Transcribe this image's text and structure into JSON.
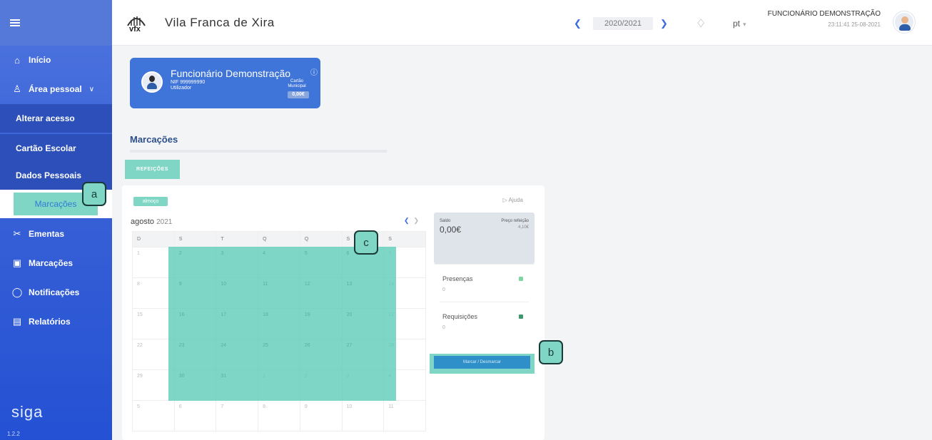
{
  "sidebar": {
    "items": [
      {
        "icon": "home-icon",
        "glyph": "⌂",
        "label": "Início"
      },
      {
        "icon": "person-icon",
        "glyph": "♙",
        "label": "Área pessoal"
      },
      {
        "label": "Alterar acesso"
      },
      {
        "label": "Cartão Escolar"
      },
      {
        "label": "Dados Pessoais"
      },
      {
        "label": "Marcações"
      },
      {
        "icon": "cutlery-icon",
        "glyph": "✂",
        "label": "Ementas"
      },
      {
        "icon": "calendar-icon",
        "glyph": "▣",
        "label": "Marcações"
      },
      {
        "icon": "bell-icon",
        "glyph": "♫",
        "label": "Notificações"
      },
      {
        "icon": "report-icon",
        "glyph": "▤",
        "label": "Relatórios"
      }
    ],
    "brand": "siga",
    "version": "1.2.2"
  },
  "header": {
    "logo_text": "vfx",
    "title": "Vila Franca de Xira",
    "year": "2020/2021",
    "lang": "pt",
    "user_name": "FUNCIONÁRIO DEMONSTRAÇÃO",
    "user_time": "23:11:41 25-08-2021"
  },
  "user_card": {
    "name": "Funcionário Demonstração",
    "info_icon": "ⓘ",
    "nif": "NIF 999999990",
    "role": "Utilizador",
    "cartao": "Cartão Municipal",
    "saldo": "0,00€"
  },
  "section": {
    "title": "Marcações",
    "tab": "REFEIÇÕES"
  },
  "panel": {
    "chip": "almoço",
    "help": "Ajuda",
    "month": "agosto",
    "year": "2021",
    "weekdays": [
      "D",
      "S",
      "T",
      "Q",
      "Q",
      "S",
      "S"
    ],
    "weeks": [
      [
        "1",
        "2",
        "3",
        "4",
        "5",
        "6",
        "7"
      ],
      [
        "8",
        "9",
        "10",
        "11",
        "12",
        "13",
        "14"
      ],
      [
        "15",
        "16",
        "17",
        "18",
        "19",
        "20",
        "21"
      ],
      [
        "22",
        "23",
        "24",
        "25",
        "26",
        "27",
        "28"
      ],
      [
        "29",
        "30",
        "31",
        "1",
        "2",
        "3",
        "4"
      ],
      [
        "5",
        "6",
        "7",
        "8",
        "9",
        "10",
        "11"
      ]
    ],
    "saldo_label": "Saldo",
    "saldo_value": "0,00€",
    "preco_label": "Preço refeição",
    "preco_value": "4,10€",
    "presencas_label": "Presenças",
    "presencas_value": "0",
    "requisicoes_label": "Requisições",
    "requisicoes_value": "0",
    "mark_button": "Marcar / Desmarcar"
  },
  "badges": {
    "a": "a",
    "b": "b",
    "c": "c"
  },
  "colors": {
    "accent": "#7fd6c5",
    "sidebar": "#3a62d6",
    "primary": "#3f74d8"
  }
}
